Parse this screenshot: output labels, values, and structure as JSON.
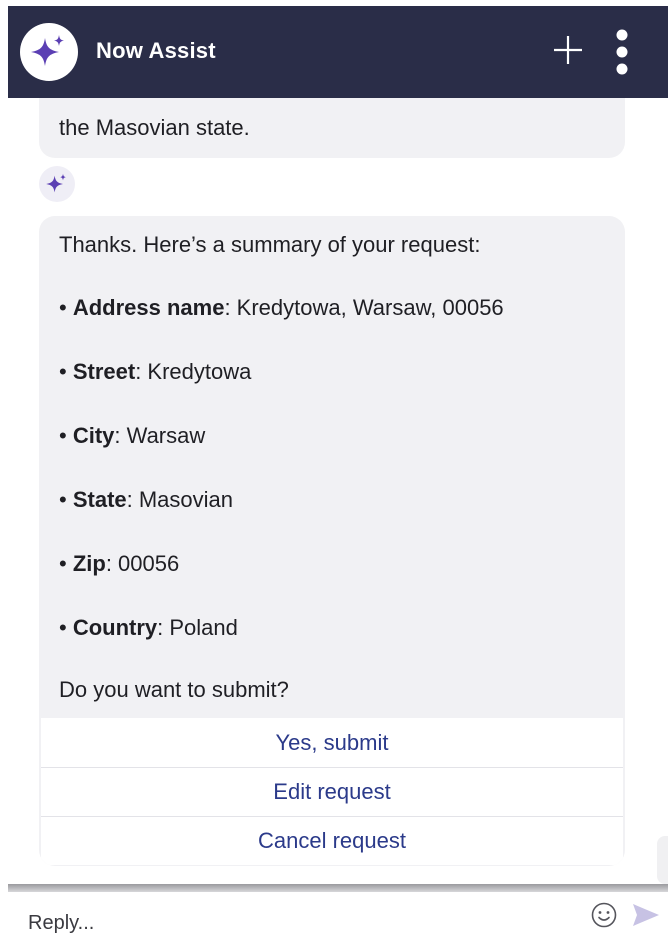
{
  "header": {
    "title": "Now Assist",
    "avatar_icon": "sparkle-icon",
    "new_chat_icon": "plus-icon",
    "menu_icon": "kebab-menu-icon",
    "bg_color": "#2a2d48",
    "accent_color": "#5b3fb3"
  },
  "conversation": {
    "previous_message_tail": "the Masovian state.",
    "bot_avatar_icon": "sparkle-icon",
    "summary": {
      "intro": "Thanks. Here’s a summary of your request:",
      "fields": [
        {
          "label": "Address name",
          "value": ": Kredytowa, Warsaw, 00056"
        },
        {
          "label": "Street",
          "value": ": Kredytowa"
        },
        {
          "label": "City",
          "value": ": Warsaw"
        },
        {
          "label": "State",
          "value": ": Masovian"
        },
        {
          "label": "Zip",
          "value": ": 00056"
        },
        {
          "label": "Country",
          "value": ": Poland"
        }
      ],
      "bullet": "•",
      "question": "Do you want to submit?",
      "options": [
        "Yes, submit",
        "Edit request",
        "Cancel request"
      ]
    }
  },
  "reply": {
    "placeholder": "Reply...",
    "value": "",
    "emoji_icon": "smiley-icon",
    "send_icon": "send-icon"
  }
}
